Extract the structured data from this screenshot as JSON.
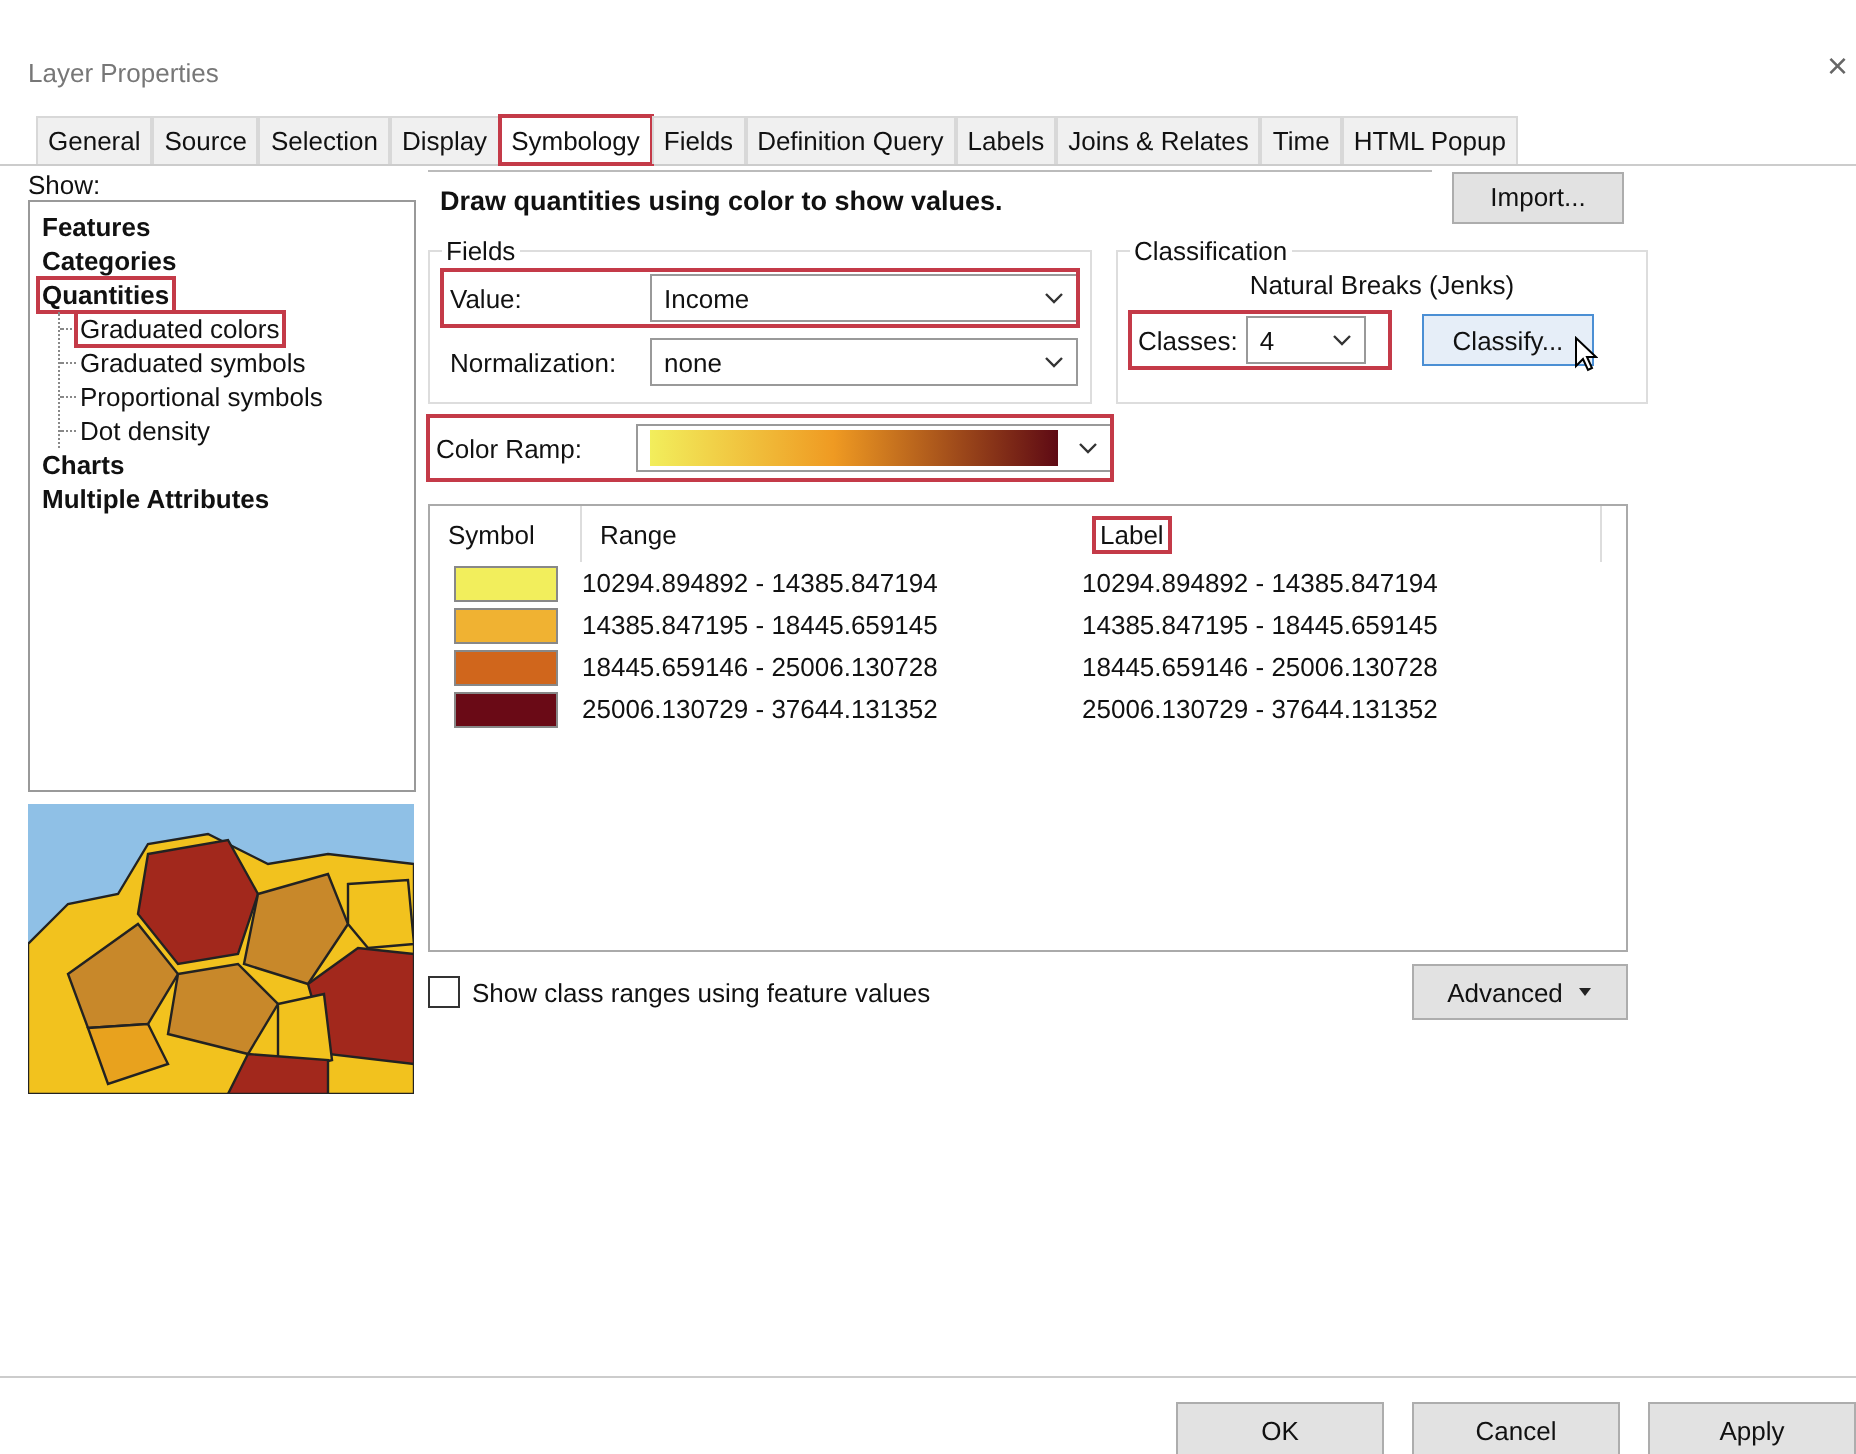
{
  "window": {
    "title": "Layer Properties",
    "close": "×"
  },
  "tabs": [
    {
      "label": "General",
      "selected": false,
      "highlighted": false
    },
    {
      "label": "Source",
      "selected": false,
      "highlighted": false
    },
    {
      "label": "Selection",
      "selected": false,
      "highlighted": false
    },
    {
      "label": "Display",
      "selected": false,
      "highlighted": false
    },
    {
      "label": "Symbology",
      "selected": true,
      "highlighted": true
    },
    {
      "label": "Fields",
      "selected": false,
      "highlighted": false
    },
    {
      "label": "Definition Query",
      "selected": false,
      "highlighted": false
    },
    {
      "label": "Labels",
      "selected": false,
      "highlighted": false
    },
    {
      "label": "Joins & Relates",
      "selected": false,
      "highlighted": false
    },
    {
      "label": "Time",
      "selected": false,
      "highlighted": false
    },
    {
      "label": "HTML Popup",
      "selected": false,
      "highlighted": false
    }
  ],
  "show": {
    "label": "Show:",
    "tree": [
      {
        "label": "Features",
        "highlighted": false
      },
      {
        "label": "Categories",
        "highlighted": false
      },
      {
        "label": "Quantities",
        "highlighted": true,
        "children": [
          {
            "label": "Graduated colors",
            "highlighted": true
          },
          {
            "label": "Graduated symbols",
            "highlighted": false
          },
          {
            "label": "Proportional symbols",
            "highlighted": false
          },
          {
            "label": "Dot density",
            "highlighted": false
          }
        ]
      },
      {
        "label": "Charts",
        "highlighted": false
      },
      {
        "label": "Multiple Attributes",
        "highlighted": false
      }
    ]
  },
  "description": "Draw quantities using color to show values.",
  "import_button": "Import...",
  "fields": {
    "title": "Fields",
    "value": {
      "label": "Value:",
      "value": "Income",
      "highlighted": true
    },
    "normalization": {
      "label": "Normalization:",
      "value": "none",
      "highlighted": false
    }
  },
  "classification": {
    "title": "Classification",
    "method": "Natural Breaks (Jenks)",
    "classes": {
      "label": "Classes:",
      "value": "4",
      "highlighted": true
    },
    "classify_button": "Classify..."
  },
  "color_ramp": {
    "label": "Color Ramp:",
    "highlighted": true
  },
  "table": {
    "columns": [
      {
        "label": "Symbol",
        "highlighted": false
      },
      {
        "label": "Range",
        "highlighted": false
      },
      {
        "label": "Label",
        "highlighted": true
      }
    ],
    "rows": [
      {
        "color": "#f2ee5c",
        "range": "10294.894892 - 14385.847194",
        "label": "10294.894892 - 14385.847194"
      },
      {
        "color": "#f0b232",
        "range": "14385.847195 - 18445.659145",
        "label": "14385.847195 - 18445.659145"
      },
      {
        "color": "#d0661c",
        "range": "18445.659146 - 25006.130728",
        "label": "18445.659146 - 25006.130728"
      },
      {
        "color": "#6a0a16",
        "range": "25006.130729 - 37644.131352",
        "label": "25006.130729 - 37644.131352"
      }
    ]
  },
  "show_class_ranges": {
    "label": "Show class ranges using feature values",
    "checked": false
  },
  "advanced_button": "Advanced",
  "buttons": [
    "OK",
    "Cancel",
    "Apply"
  ]
}
